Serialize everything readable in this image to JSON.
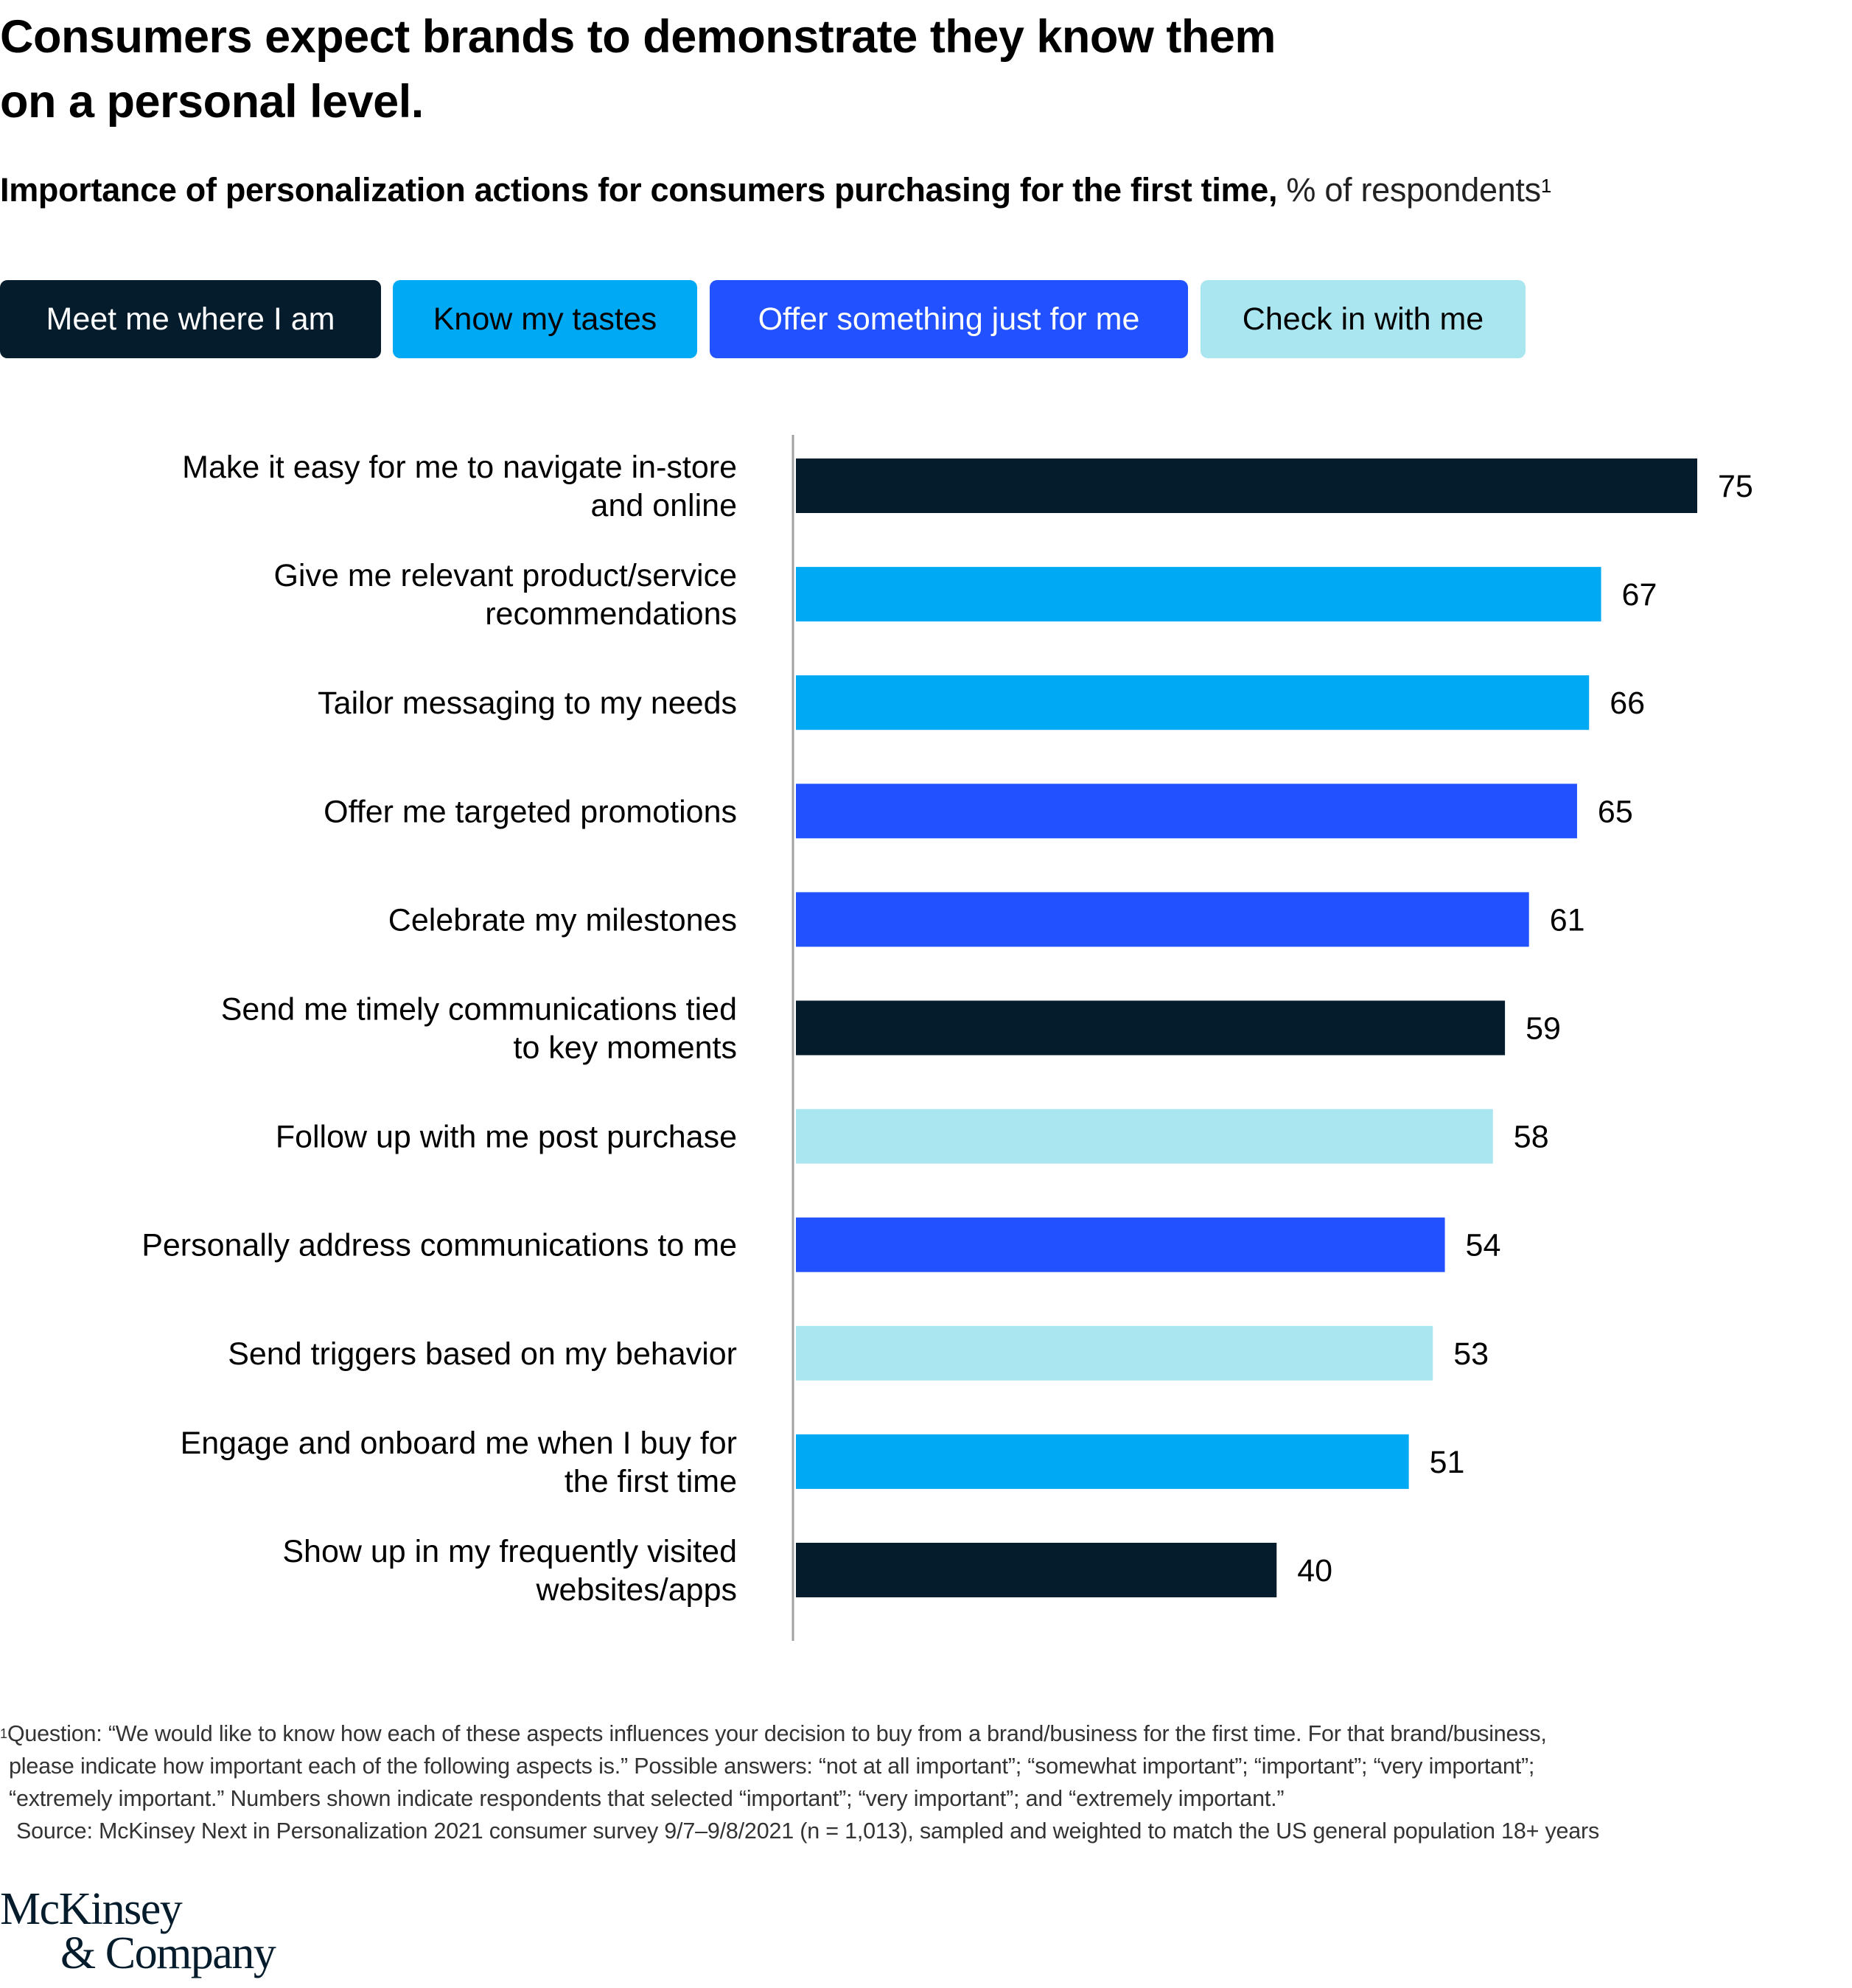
{
  "header": {
    "title_line1": "Consumers expect brands to demonstrate they know them",
    "title_line2": "on a personal level.",
    "subtitle_bold": "Importance of personalization actions for consumers purchasing for the first time,",
    "subtitle_unit": " % of respondents",
    "subtitle_footnote_ref": "1"
  },
  "legend": [
    {
      "key": "meet",
      "label": "Meet me where I am",
      "color": "#051c2c",
      "text_color": "#ffffff"
    },
    {
      "key": "tastes",
      "label": "Know my tastes",
      "color": "#00a9f4",
      "text_color": "#000000"
    },
    {
      "key": "offer",
      "label": "Offer something just for me",
      "color": "#2251ff",
      "text_color": "#ffffff"
    },
    {
      "key": "checkin",
      "label": "Check in with me",
      "color": "#aae6f0",
      "text_color": "#000000"
    }
  ],
  "chart_data": {
    "type": "bar",
    "orientation": "horizontal",
    "title": "Importance of personalization actions for consumers purchasing for the first time",
    "xlabel": "% of respondents",
    "ylabel": "",
    "xlim": [
      0,
      75
    ],
    "grid": false,
    "legend_position": "top-left",
    "categories": [
      [
        "Make it easy for me to navigate in-store",
        "and online"
      ],
      [
        "Give me relevant product/service",
        "recommendations"
      ],
      [
        "Tailor messaging to my needs"
      ],
      [
        "Offer me targeted promotions"
      ],
      [
        "Celebrate my milestones"
      ],
      [
        "Send me timely communications tied",
        "to key moments"
      ],
      [
        "Follow up with me post purchase"
      ],
      [
        "Personally address communications to me"
      ],
      [
        "Send triggers based on my behavior"
      ],
      [
        "Engage and onboard me when I buy for",
        "the first time"
      ],
      [
        "Show up in my frequently visited",
        "websites/apps"
      ]
    ],
    "values": [
      75,
      67,
      66,
      65,
      61,
      59,
      58,
      54,
      53,
      51,
      40
    ],
    "groups": [
      "meet",
      "tastes",
      "tastes",
      "offer",
      "offer",
      "meet",
      "checkin",
      "offer",
      "checkin",
      "tastes",
      "meet"
    ],
    "series": [
      {
        "name": "Meet me where I am",
        "key": "meet"
      },
      {
        "name": "Know my tastes",
        "key": "tastes"
      },
      {
        "name": "Offer something just for me",
        "key": "offer"
      },
      {
        "name": "Check in with me",
        "key": "checkin"
      }
    ],
    "axis_color": "#a0a0a0"
  },
  "footnote": {
    "marker": "1",
    "line1": "Question: “We would like to know how each of these aspects influences your decision to buy from a brand/business for the first time. For that brand/business,",
    "line2": "please indicate how important each of the following aspects is.” Possible answers: “not at all important”; “somewhat important”; “important”; “very important”;",
    "line3": "“extremely important.” Numbers shown indicate respondents that selected “important”; “very important”; and “extremely important.”",
    "source": "Source: McKinsey Next in Personalization 2021 consumer survey 9/7–9/8/2021 (n = 1,013), sampled and weighted to match the US general population 18+ years"
  },
  "logo": {
    "line1": "McKinsey",
    "line2": "& Company"
  }
}
